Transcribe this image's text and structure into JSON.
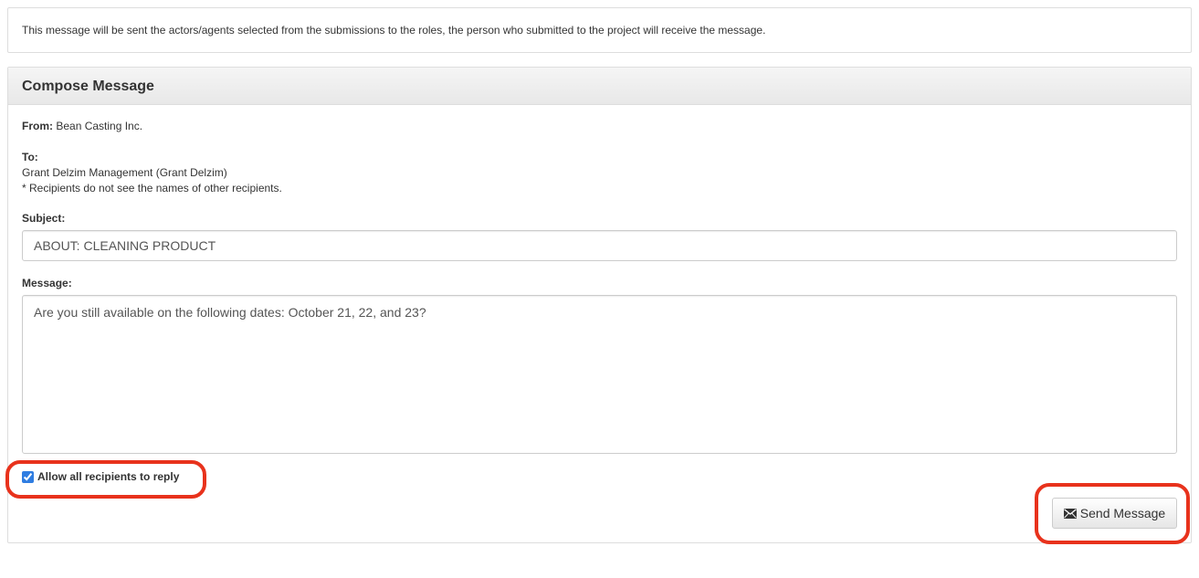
{
  "info": {
    "text": "This message will be sent the actors/agents selected from the submissions to the roles, the person who submitted to the project will receive the message."
  },
  "compose": {
    "title": "Compose Message",
    "from_label": "From:",
    "from_value": "Bean Casting Inc.",
    "to_label": "To:",
    "to_value": "Grant Delzim Management (Grant Delzim)",
    "to_note": "* Recipients do not see the names of other recipients.",
    "subject_label": "Subject:",
    "subject_value": "ABOUT: CLEANING PRODUCT",
    "message_label": "Message:",
    "message_value": "Are you still available on the following dates: October 21, 22, and 23?",
    "allow_reply_label": "Allow all recipients to reply",
    "allow_reply_checked": true,
    "send_label": "Send Message",
    "send_icon": "envelope-icon"
  },
  "colors": {
    "highlight": "#e8321c",
    "panel_border": "#dddddd",
    "header_bg": "#eeeeee"
  }
}
